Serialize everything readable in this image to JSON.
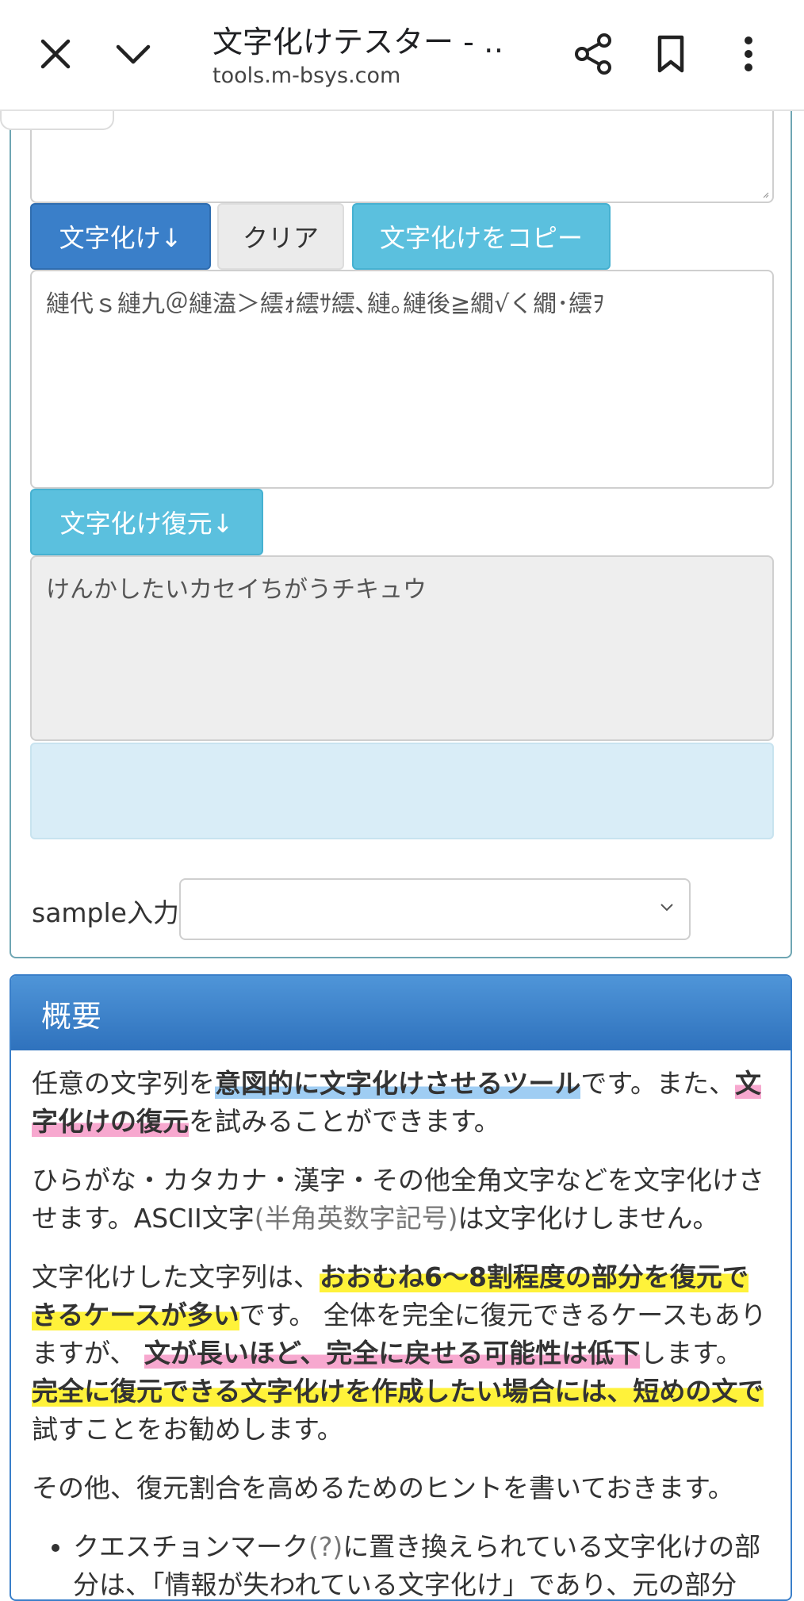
{
  "browser": {
    "title": "文字化けテスター - …",
    "url": "tools.m-bsys.com"
  },
  "tool": {
    "mojibake_button": "文字化け↓",
    "clear_button": "クリア",
    "copy_button": "文字化けをコピー",
    "mojibake_output": "縺代ｓ縺九＠縺溘＞繧ｫ繧ｻ繧､縺｡縺後≧繝√く繝･繧ｦ",
    "restore_button": "文字化け復元↓",
    "restore_output": "けんかしたいカセイちがうチキュウ",
    "sample_label": "sample入力",
    "sample_selected": ""
  },
  "overview": {
    "heading": "概要",
    "p1_a": "任意の文字列を",
    "p1_b": "意図的に文字化けさせるツール",
    "p1_c": "です。また、",
    "p1_d": "文字化けの復元",
    "p1_e": "を試みることができます。",
    "p2_a": "ひらがな・カタカナ・漢字・その他全角文字などを文字化けさせます。ASCII文字",
    "p2_b": "(半角英数字記号)",
    "p2_c": "は文字化けしません。",
    "p3_a": "文字化けした文字列は、",
    "p3_b": "おおむね6〜8割程度の部分を復元できるケースが多い",
    "p3_c": "です。 全体を完全に復元できるケースもありますが、",
    "p3_d": "文が長いほど、完全に戻せる可能性は低下",
    "p3_e": "します。",
    "p3_f": "完全に復元できる文字化けを作成したい場合には、短めの文で",
    "p3_g": "試すことをお勧めします。",
    "p4": "その他、復元割合を高めるためのヒントを書いておきます。",
    "li1_a": "クエスチョンマーク",
    "li1_b": "(?)",
    "li1_c": "に置き換えられている文字化けの部分は、「情報が失われている文字化け」であり、元の部分"
  },
  "colors": {
    "primary": "#3a7fc9",
    "info": "#5bc0de",
    "highlight_yellow": "#fff23a",
    "highlight_pink": "#f7a8cf",
    "highlight_blue": "#9fcdf3"
  },
  "icons": [
    "close-icon",
    "chevron-down-icon",
    "share-icon",
    "bookmark-icon",
    "more-vert-icon"
  ]
}
